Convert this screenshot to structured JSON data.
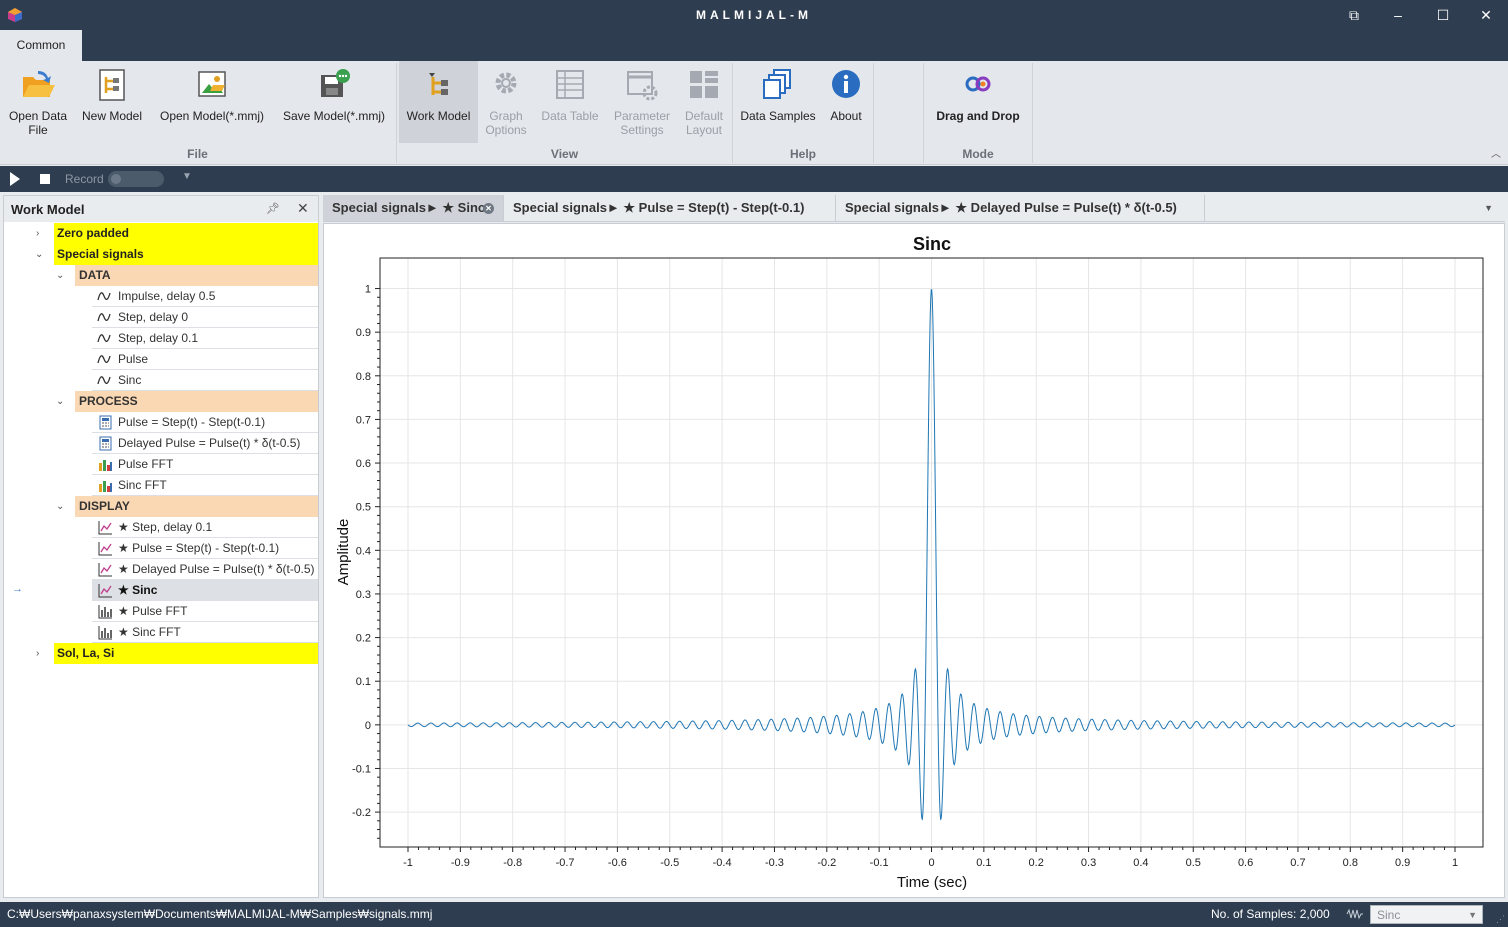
{
  "window": {
    "title": "MALMIJAL-M",
    "buttons": [
      "restore-icon",
      "minimize-icon",
      "maximize-icon",
      "close-icon"
    ]
  },
  "ribbon": {
    "tab_label": "Common",
    "buttons": {
      "open_data_file": "Open Data\nFile",
      "new_model": "New Model",
      "open_model": "Open Model(*.mmj)",
      "save_model": "Save Model(*.mmj)",
      "work_model": "Work Model",
      "graph_options": "Graph\nOptions",
      "data_table": "Data Table",
      "parameter_settings": "Parameter\nSettings",
      "default_layout": "Default\nLayout",
      "data_samples": "Data Samples",
      "about": "About",
      "drag_and_drop": "Drag and Drop"
    },
    "groups": {
      "file": "File",
      "view": "View",
      "help": "Help",
      "mode": "Mode"
    }
  },
  "recordbar": {
    "record_label": "Record"
  },
  "work_model": {
    "title": "Work Model",
    "tree": {
      "zero_padded": "Zero padded",
      "special_signals": "Special signals",
      "data_cat": "DATA",
      "data_items": [
        "Impulse, delay 0.5",
        "Step, delay 0",
        "Step, delay 0.1",
        "Pulse",
        "Sinc"
      ],
      "process_cat": "PROCESS",
      "process_items": [
        "Pulse = Step(t) - Step(t-0.1)",
        "Delayed Pulse = Pulse(t) * δ(t-0.5)",
        "Pulse FFT",
        "Sinc FFT"
      ],
      "display_cat": "DISPLAY",
      "display_items": [
        "★ Step, delay 0.1",
        "★ Pulse = Step(t) - Step(t-0.1)",
        "★ Delayed Pulse = Pulse(t) * δ(t-0.5)",
        "★ Sinc",
        "★ Pulse FFT",
        "★ Sinc FFT"
      ],
      "sol_la_si": "Sol, La, Si"
    }
  },
  "doc_tabs": [
    "Special signals► ★ Sinc",
    "Special signals► ★ Pulse = Step(t) - Step(t-0.1)",
    "Special signals► ★ Delayed Pulse = Pulse(t) * δ(t-0.5)"
  ],
  "chart_data": {
    "type": "line",
    "title": "Sinc",
    "xlabel": "Time (sec)",
    "ylabel": "Amplitude",
    "xlim": [
      -1,
      1
    ],
    "ylim": [
      -0.28,
      1.07
    ],
    "x_ticks": [
      "-1",
      "-0.9",
      "-0.8",
      "-0.7",
      "-0.6",
      "-0.5",
      "-0.4",
      "-0.3",
      "-0.2",
      "-0.1",
      "0",
      "0.1",
      "0.2",
      "0.3",
      "0.4",
      "0.5",
      "0.6",
      "0.7",
      "0.8",
      "0.9",
      "1"
    ],
    "y_ticks": [
      "1",
      "0.9",
      "0.8",
      "0.7",
      "0.6",
      "0.5",
      "0.4",
      "0.3",
      "0.2",
      "0.1",
      "0",
      "-0.1",
      "-0.2"
    ],
    "grid": true,
    "series": [
      {
        "function": "sin(2*pi*f*t)/(2*pi*f*t)",
        "f": 40,
        "n_samples": 2000,
        "color": "#1f77b4"
      }
    ]
  },
  "statusbar": {
    "path": "C:₩Users₩panaxsystem₩Documents₩MALMIJAL-M₩Samples₩signals.mmj",
    "samples": "No. of Samples: 2,000",
    "selected_series": "Sinc"
  }
}
